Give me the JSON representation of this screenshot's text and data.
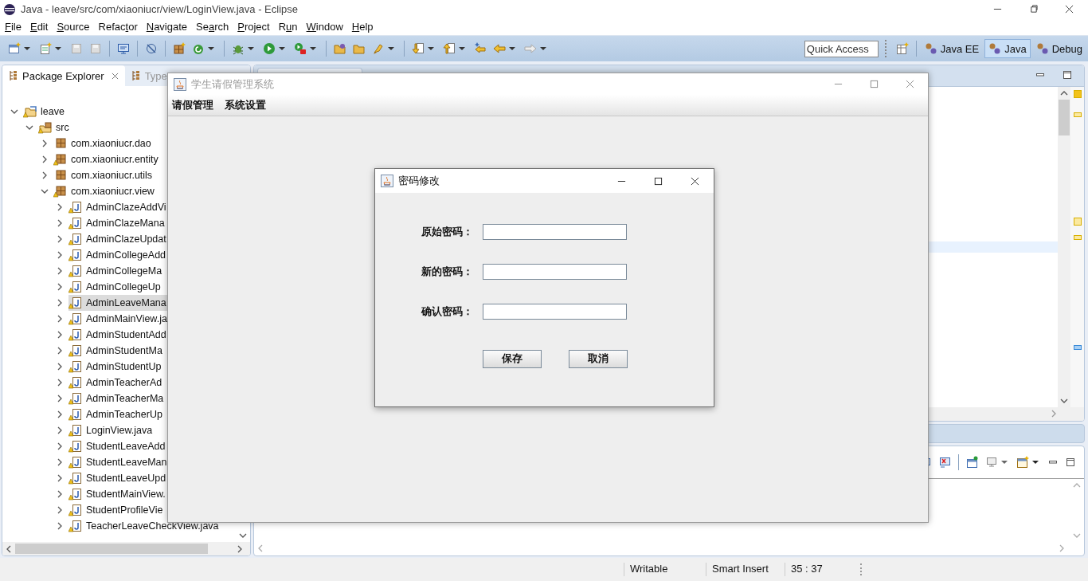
{
  "window": {
    "title": "Java - leave/src/com/xiaoniucr/view/LoginView.java - Eclipse"
  },
  "menu": [
    {
      "key": "F",
      "rest": "ile"
    },
    {
      "key": "E",
      "rest": "dit"
    },
    {
      "key": "S",
      "rest": "ource"
    },
    {
      "before": "Refac",
      "key": "t",
      "rest": "or"
    },
    {
      "key": "N",
      "rest": "avigate"
    },
    {
      "before": "Se",
      "key": "a",
      "rest": "rch"
    },
    {
      "key": "P",
      "rest": "roject"
    },
    {
      "before": "R",
      "key": "u",
      "rest": "n"
    },
    {
      "key": "W",
      "rest": "indow"
    },
    {
      "key": "H",
      "rest": "elp"
    }
  ],
  "quick_access": {
    "placeholder": "Quick Access"
  },
  "perspectives": [
    {
      "label": "Java EE",
      "selected": false
    },
    {
      "label": "Java",
      "selected": true
    },
    {
      "label": "Debug",
      "selected": false
    }
  ],
  "left_tabs": [
    {
      "label": "Package Explorer",
      "selected": true
    },
    {
      "label": "Type",
      "selected": false
    }
  ],
  "tree": [
    {
      "label": "leave",
      "kind": "project",
      "expanded": true,
      "selected": false,
      "warning": true,
      "children": [
        {
          "label": "src",
          "kind": "source-folder",
          "expanded": true,
          "selected": false,
          "warning": true,
          "children": [
            {
              "label": "com.xiaoniucr.dao",
              "kind": "package",
              "expanded": false,
              "selected": false,
              "warning": false
            },
            {
              "label": "com.xiaoniucr.entity",
              "kind": "package",
              "expanded": false,
              "selected": false,
              "warning": true
            },
            {
              "label": "com.xiaoniucr.utils",
              "kind": "package",
              "expanded": false,
              "selected": false,
              "warning": false
            },
            {
              "label": "com.xiaoniucr.view",
              "kind": "package",
              "expanded": true,
              "selected": false,
              "warning": true,
              "children": [
                {
                  "label": "AdminClazeAddVi",
                  "kind": "java-file",
                  "expanded": false,
                  "selected": false,
                  "warning": true
                },
                {
                  "label": "AdminClazeMana",
                  "kind": "java-file",
                  "expanded": false,
                  "selected": false,
                  "warning": true
                },
                {
                  "label": "AdminClazeUpdat",
                  "kind": "java-file",
                  "expanded": false,
                  "selected": false,
                  "warning": true
                },
                {
                  "label": "AdminCollegeAdd",
                  "kind": "java-file",
                  "expanded": false,
                  "selected": false,
                  "warning": true
                },
                {
                  "label": "AdminCollegeMa",
                  "kind": "java-file",
                  "expanded": false,
                  "selected": false,
                  "warning": true
                },
                {
                  "label": "AdminCollegeUp",
                  "kind": "java-file",
                  "expanded": false,
                  "selected": false,
                  "warning": true
                },
                {
                  "label": "AdminLeaveMana",
                  "kind": "java-file",
                  "expanded": false,
                  "selected": true,
                  "warning": true
                },
                {
                  "label": "AdminMainView.ja",
                  "kind": "java-file",
                  "expanded": false,
                  "selected": false,
                  "warning": true
                },
                {
                  "label": "AdminStudentAdd",
                  "kind": "java-file",
                  "expanded": false,
                  "selected": false,
                  "warning": true
                },
                {
                  "label": "AdminStudentMa",
                  "kind": "java-file",
                  "expanded": false,
                  "selected": false,
                  "warning": true
                },
                {
                  "label": "AdminStudentUp",
                  "kind": "java-file",
                  "expanded": false,
                  "selected": false,
                  "warning": true
                },
                {
                  "label": "AdminTeacherAd",
                  "kind": "java-file",
                  "expanded": false,
                  "selected": false,
                  "warning": true
                },
                {
                  "label": "AdminTeacherMa",
                  "kind": "java-file",
                  "expanded": false,
                  "selected": false,
                  "warning": true
                },
                {
                  "label": "AdminTeacherUp",
                  "kind": "java-file",
                  "expanded": false,
                  "selected": false,
                  "warning": true
                },
                {
                  "label": "LoginView.java",
                  "kind": "java-file",
                  "expanded": false,
                  "selected": false,
                  "warning": true
                },
                {
                  "label": "StudentLeaveAdd",
                  "kind": "java-file",
                  "expanded": false,
                  "selected": false,
                  "warning": true
                },
                {
                  "label": "StudentLeaveMan",
                  "kind": "java-file",
                  "expanded": false,
                  "selected": false,
                  "warning": true
                },
                {
                  "label": "StudentLeaveUpd",
                  "kind": "java-file",
                  "expanded": false,
                  "selected": false,
                  "warning": true
                },
                {
                  "label": "StudentMainView.",
                  "kind": "java-file",
                  "expanded": false,
                  "selected": false,
                  "warning": true
                },
                {
                  "label": "StudentProfileVie",
                  "kind": "java-file",
                  "expanded": false,
                  "selected": false,
                  "warning": true
                },
                {
                  "label": "TeacherLeaveCheckView.java",
                  "kind": "java-file",
                  "expanded": false,
                  "selected": false,
                  "warning": true
                }
              ]
            }
          ]
        }
      ]
    }
  ],
  "status_bar": [
    "Writable",
    "Smart Insert",
    "35 : 37"
  ],
  "app_window": {
    "title": "学生请假管理系统",
    "menu": [
      "请假管理",
      "系统设置"
    ]
  },
  "dialog": {
    "title": "密码修改",
    "fields": [
      {
        "label": "原始密码："
      },
      {
        "label": "新的密码："
      },
      {
        "label": "确认密码："
      }
    ],
    "buttons": [
      "保存",
      "取消"
    ]
  }
}
